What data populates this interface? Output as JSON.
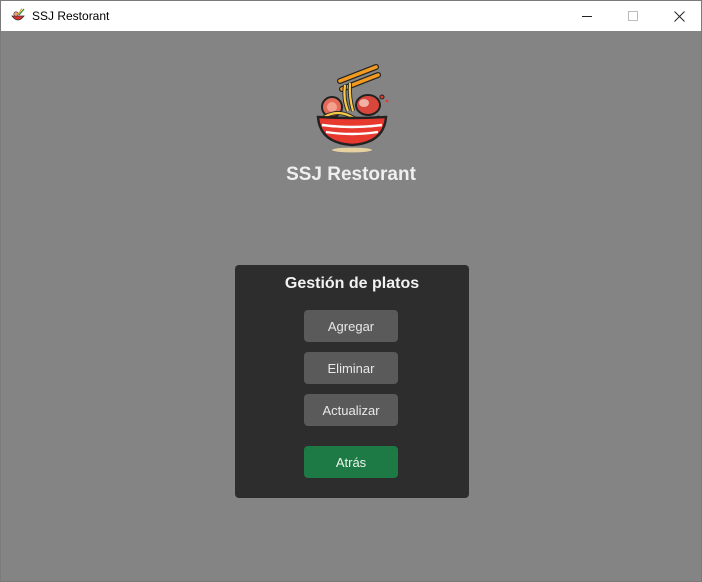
{
  "window": {
    "title": "SSJ Restorant",
    "app_icon": "ramen-icon",
    "controls": [
      "minimize-icon",
      "maximize-icon",
      "close-icon"
    ]
  },
  "header": {
    "logo": "ramen-bowl-logo",
    "title": "SSJ Restorant"
  },
  "panel": {
    "title": "Gestión de platos",
    "buttons": {
      "add": "Agregar",
      "delete": "Eliminar",
      "update": "Actualizar",
      "back": "Atrás"
    }
  },
  "colors": {
    "background": "#848484",
    "panel": "#2d2d2d",
    "button": "#5a5a5a",
    "back_button": "#1e7a45",
    "text": "#efefef"
  }
}
